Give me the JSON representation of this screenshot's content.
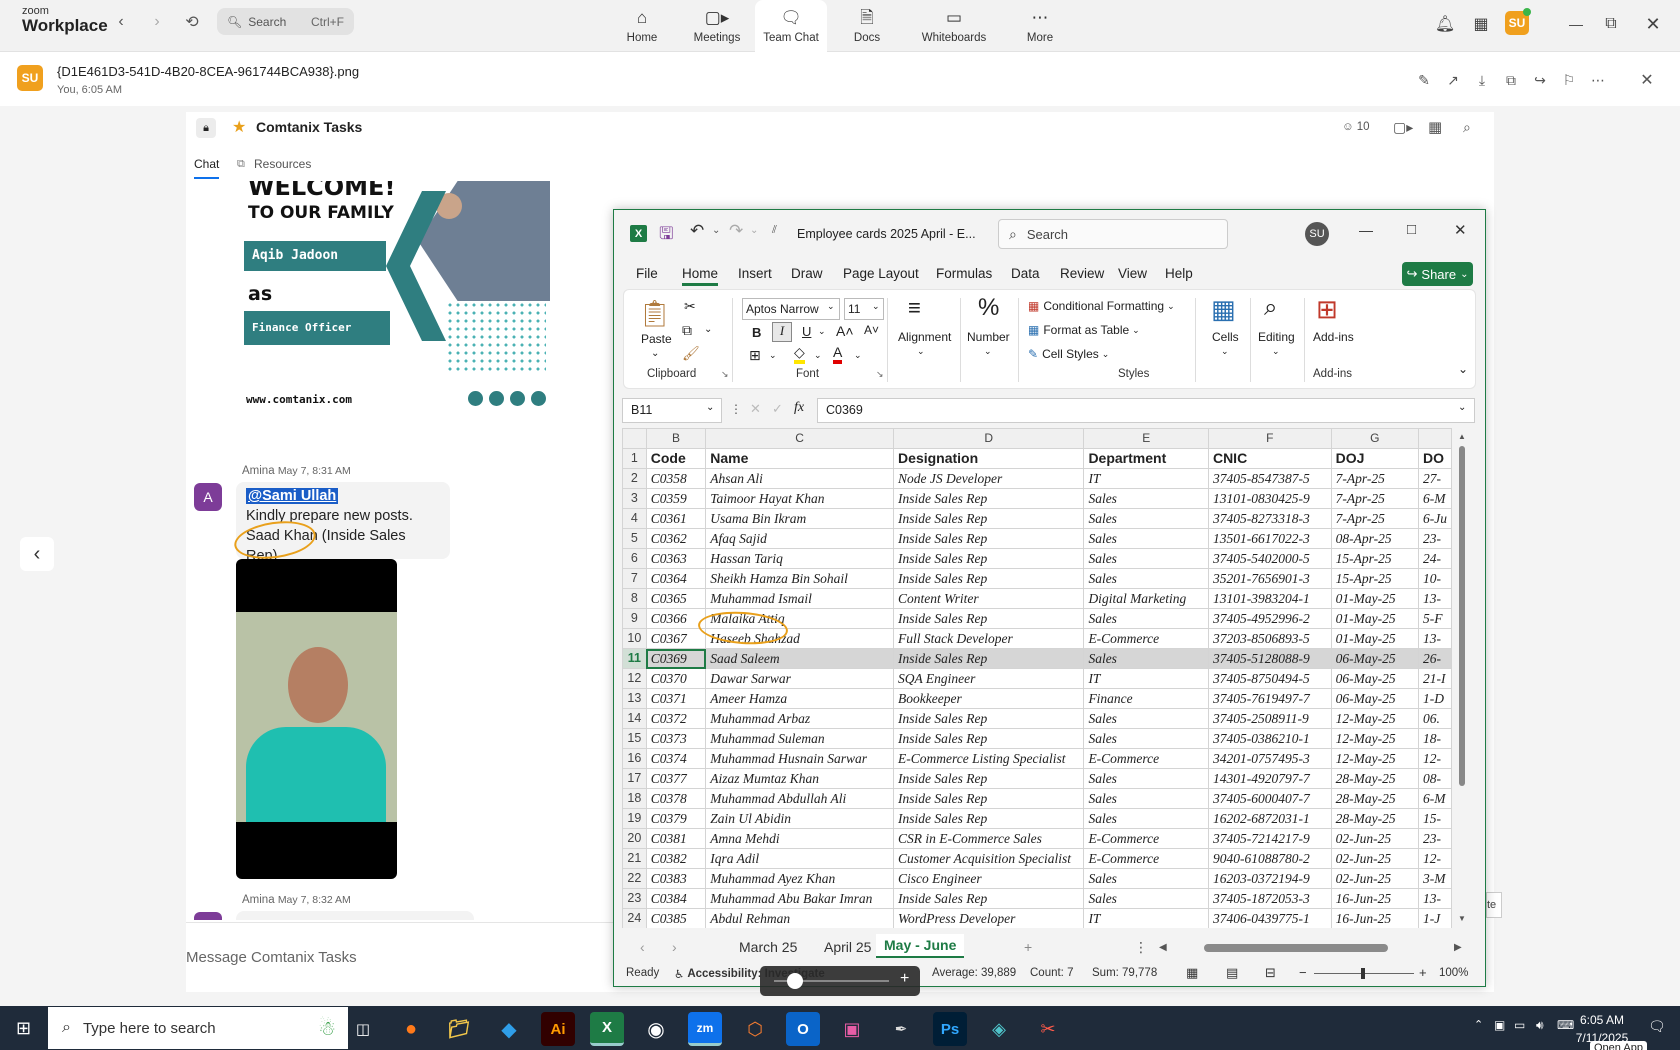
{
  "zoom": {
    "logo_top": "zoom",
    "logo_bottom": "Workplace",
    "search_placeholder": "Search",
    "search_hotkey": "Ctrl+F",
    "nav": [
      {
        "label": "Home",
        "icon": "home-icon"
      },
      {
        "label": "Meetings",
        "icon": "video-icon"
      },
      {
        "label": "Team Chat",
        "icon": "chat-icon"
      },
      {
        "label": "Docs",
        "icon": "docs-icon"
      },
      {
        "label": "Whiteboards",
        "icon": "whiteboard-icon"
      },
      {
        "label": "More",
        "icon": "more-icon"
      }
    ],
    "active_nav": "Team Chat",
    "user_initials": "SU",
    "accent": "#0e71eb"
  },
  "file": {
    "name": "{D1E461D3-541D-4B20-8CEA-961744BCA938}.png",
    "sub": "You, 6:05 AM",
    "avatar": "SU"
  },
  "channel": {
    "name": "Comtanix Tasks",
    "members": "10",
    "tabs": [
      "Chat",
      "Resources"
    ]
  },
  "card": {
    "welcome": "WELCOME!",
    "family": "TO OUR FAMILY",
    "person": "Aqib Jadoon",
    "as": "as",
    "role": "Finance Officer",
    "website": "www.comtanix.com"
  },
  "messages": [
    {
      "sender": "Amina",
      "time": "May 7, 8:31 AM",
      "avatar": "A",
      "mention": "@Sami Ullah",
      "line1": "Kindly prepare new posts.",
      "line2": "Saad Khan (Inside Sales Rep)"
    },
    {
      "sender": "Amina",
      "time": "May 7, 8:32 AM"
    }
  ],
  "composer_placeholder": "Message Comtanix Tasks",
  "excel": {
    "title": "Employee cards 2025 April  -  E...",
    "search": "Search",
    "user": "SU",
    "menu": [
      "File",
      "Home",
      "Insert",
      "Draw",
      "Page Layout",
      "Formulas",
      "Data",
      "Review",
      "View",
      "Help"
    ],
    "share": "Share",
    "ribbon": {
      "paste": "Paste",
      "clipboard": "Clipboard",
      "font_name": "Aptos Narrow",
      "font_size": "11",
      "font": "Font",
      "alignment": "Alignment",
      "number": "Number",
      "cond_format": "Conditional Formatting",
      "format_table": "Format as Table",
      "cell_styles": "Cell Styles",
      "styles": "Styles",
      "cells": "Cells",
      "editing": "Editing",
      "addins": "Add-ins",
      "addins_group": "Add-ins"
    },
    "name_box": "B11",
    "formula": "C0369",
    "columns": [
      "B",
      "C",
      "D",
      "E",
      "F",
      "G"
    ],
    "header_row": [
      "Code",
      "Name",
      "Designation",
      "Department",
      "CNIC",
      "DOJ",
      "DO"
    ],
    "rows": [
      [
        "C0358",
        "Ahsan Ali",
        "Node JS Developer",
        "IT",
        "37405-8547387-5",
        "7-Apr-25",
        "27-"
      ],
      [
        "C0359",
        "Taimoor Hayat Khan",
        "Inside Sales Rep",
        "Sales",
        "13101-0830425-9",
        "7-Apr-25",
        "6-M"
      ],
      [
        "C0361",
        "Usama Bin Ikram",
        "Inside Sales Rep",
        "Sales",
        "37405-8273318-3",
        "7-Apr-25",
        "6-Ju"
      ],
      [
        "C0362",
        "Afaq Sajid",
        "Inside Sales Rep",
        "Sales",
        "13501-6617022-3",
        "08-Apr-25",
        "23-"
      ],
      [
        "C0363",
        "Hassan Tariq",
        "Inside Sales Rep",
        "Sales",
        "37405-5402000-5",
        "15-Apr-25",
        "24-"
      ],
      [
        "C0364",
        "Sheikh Hamza Bin Sohail",
        "Inside Sales Rep",
        "Sales",
        "35201-7656901-3",
        "15-Apr-25",
        "10-"
      ],
      [
        "C0365",
        "Muhammad Ismail",
        "Content Writer",
        "Digital Marketing",
        "13101-3983204-1",
        "01-May-25",
        "13-"
      ],
      [
        "C0366",
        "Malaika Attiq",
        "Inside Sales Rep",
        "Sales",
        "37405-4952996-2",
        "01-May-25",
        "5-F"
      ],
      [
        "C0367",
        "Haseeb Shahzad",
        "Full Stack Developer",
        "E-Commerce",
        "37203-8506893-5",
        "01-May-25",
        "13-"
      ],
      [
        "C0369",
        "Saad Saleem",
        "Inside Sales Rep",
        "Sales",
        "37405-5128088-9",
        "06-May-25",
        "26-"
      ],
      [
        "C0370",
        "Dawar Sarwar",
        "SQA Engineer",
        "IT",
        "37405-8750494-5",
        "06-May-25",
        "21-I"
      ],
      [
        "C0371",
        "Ameer Hamza",
        "Bookkeeper",
        "Finance",
        "37405-7619497-7",
        "06-May-25",
        "1-D"
      ],
      [
        "C0372",
        "Muhammad Arbaz",
        "Inside Sales Rep",
        "Sales",
        "37405-2508911-9",
        "12-May-25",
        "06."
      ],
      [
        "C0373",
        "Muhammad Suleman",
        "Inside Sales Rep",
        "Sales",
        "37405-0386210-1",
        "12-May-25",
        "18-"
      ],
      [
        "C0374",
        "Muhammad Husnain Sarwar",
        "E-Commerce Listing Specialist",
        "E-Commerce",
        "34201-0757495-3",
        "12-May-25",
        "12-"
      ],
      [
        "C0377",
        "Aizaz Mumtaz Khan",
        "Inside Sales Rep",
        "Sales",
        "14301-4920797-7",
        "28-May-25",
        "08-"
      ],
      [
        "C0378",
        "Muhammad Abdullah Ali",
        "Inside Sales Rep",
        "Sales",
        "37405-6000407-7",
        "28-May-25",
        "6-M"
      ],
      [
        "C0379",
        "Zain Ul Abidin",
        "Inside Sales Rep",
        "Sales",
        "16202-6872031-1",
        "28-May-25",
        "15-"
      ],
      [
        "C0381",
        "Amna Mehdi",
        "CSR in E-Commerce Sales",
        "E-Commerce",
        "37405-7214217-9",
        "02-Jun-25",
        "23-"
      ],
      [
        "C0382",
        "Iqra Adil",
        "Customer Acquisition Specialist",
        "E-Commerce",
        "9040-61088780-2",
        "02-Jun-25",
        "12-"
      ],
      [
        "C0383",
        "Muhammad Ayez Khan",
        "Cisco Engineer",
        "Sales",
        "16203-0372194-9",
        "02-Jun-25",
        "3-M"
      ],
      [
        "C0384",
        "Muhammad Abu Bakar Imran",
        "Inside Sales Rep",
        "Sales",
        "37405-1872053-3",
        "16-Jun-25",
        "13-"
      ],
      [
        "C0385",
        "Abdul Rehman",
        "WordPress Developer",
        "IT",
        "37406-0439775-1",
        "16-Jun-25",
        "1-J"
      ]
    ],
    "sheets": [
      "March 25",
      "April 25",
      "May - June"
    ],
    "active_sheet": "May - June",
    "status": {
      "ready": "Ready",
      "accessibility": "Accessibility: Investigate",
      "average": "Average: 39,889",
      "count": "Count: 7",
      "sum": "Sum: 79,778",
      "zoom": "100%"
    },
    "accent": "#1e7b45"
  },
  "taskbar": {
    "search": "Type here to search",
    "time": "6:05 AM",
    "date": "7/11/2025",
    "overflow": "Open App"
  }
}
